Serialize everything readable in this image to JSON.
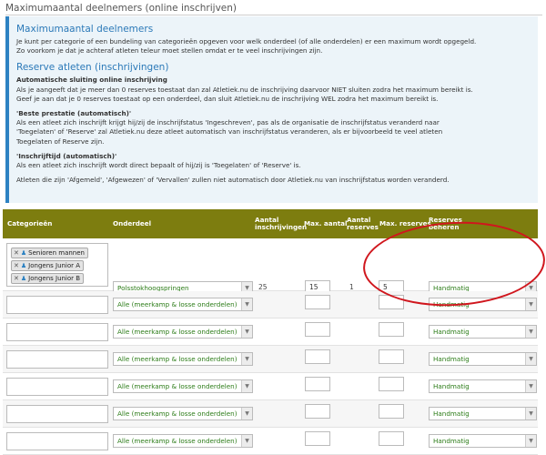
{
  "page_title": "Maximumaantal deelnemers (online inschrijven)",
  "info": {
    "heading1": "Maximumaantal deelnemers",
    "para1": "Je kunt per categorie of een bundeling van categorieën opgeven voor welk onderdeel (of alle onderdelen) er een maximum wordt opgegeld.",
    "para1b": "Zo voorkom je dat je achteraf atleten teleur moet stellen omdat er te veel inschrijvingen zijn.",
    "heading2": "Reserve atleten (inschrijvingen)",
    "sec1_title": "Automatische sluiting online inschrijving",
    "sec1_line1": "Als je aangeeft dat je meer dan 0 reserves toestaat dan zal Atletiek.nu de inschrijving daarvoor NIET sluiten zodra het maximum bereikt is.",
    "sec1_line2": "Geef je aan dat je 0 reserves toestaat op een onderdeel, dan sluit Atletiek.nu de inschrijving WEL zodra het maximum bereikt is.",
    "sec2_title": "'Beste prestatie (automatisch)'",
    "sec2_line1": "Als een atleet zich inschrijft krijgt hij/zij de inschrijfstatus 'Ingeschreven', pas als de organisatie de inschrijfstatus veranderd naar",
    "sec2_line2": "'Toegelaten' of 'Reserve' zal Atletiek.nu deze atleet automatisch van inschrijfstatus veranderen, als er bijvoorbeeld te veel atleten",
    "sec2_line3": "Toegelaten of Reserve zijn.",
    "sec3_title": "'Inschrijftijd (automatisch)'",
    "sec3_line1": "Als een atleet zich inschrijft wordt direct bepaalt of hij/zij is 'Toegelaten' of 'Reserve' is.",
    "sec4_line1": "Atleten die zijn 'Afgemeld', 'Afgewezen' of 'Vervallen' zullen niet automatisch door Atletiek.nu van inschrijfstatus worden veranderd."
  },
  "table": {
    "headers": {
      "categories": "Categorieën",
      "event": "Onderdeel",
      "registrations_1": "Aantal",
      "registrations_2": "inschrijvingen",
      "max_count": "Max. aantal",
      "reserves_1": "Aantal",
      "reserves_2": "reserves",
      "max_reserves": "Max. reserves",
      "manage_1": "Reserves",
      "manage_2": "beheren"
    },
    "first_row": {
      "tags": [
        "Senioren mannen",
        "Jongens Junior A",
        "Jongens Junior B"
      ],
      "event": "Polsstokhoogspringen",
      "registrations": "25",
      "max_count": "15",
      "reserves": "1",
      "max_reserves": "5",
      "manage": "Handmatig"
    },
    "empty_event": "Alle (meerkamp & losse onderdelen)",
    "empty_manage": "Handmatig"
  },
  "colors": {
    "header_bg": "#7d7d0f",
    "accent_blue": "#2d82c2",
    "annotation_red": "#d0161d",
    "select_text": "#2c7c18"
  },
  "icons": {
    "remove": "close-icon",
    "athlete": "person-icon",
    "dropdown": "chevron-down-icon"
  }
}
